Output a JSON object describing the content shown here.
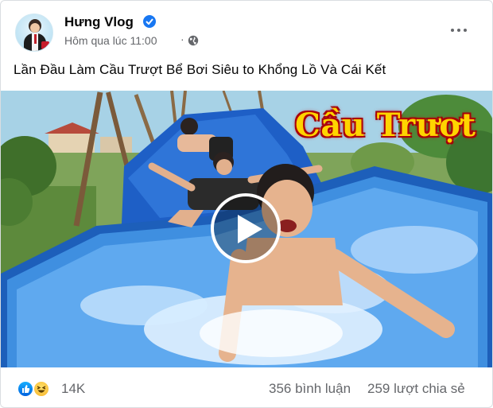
{
  "post": {
    "author": "Hưng Vlog",
    "timestamp": "Hôm qua lúc 11:00",
    "separator": "·",
    "privacy_icon": "globe-icon",
    "verified_icon": "verified-badge-icon",
    "more_icon": "more-dots-icon",
    "caption": "Lần Đầu Làm Cầu Trượt Bể Bơi Siêu to Khổng Lồ Và Cái Kết"
  },
  "video": {
    "title_overlay": "Cầu Trượt",
    "play_icon": "play-icon"
  },
  "engagement": {
    "reaction_icons": [
      "like-icon",
      "haha-icon"
    ],
    "reaction_count": "14K",
    "comments": "356 bình luận",
    "shares": "259 lượt chia sẻ"
  },
  "colors": {
    "brand_blue": "#1877f2",
    "secondary_text": "#65676b",
    "overlay_title": "#ffd400",
    "overlay_outline": "#b8000a"
  }
}
